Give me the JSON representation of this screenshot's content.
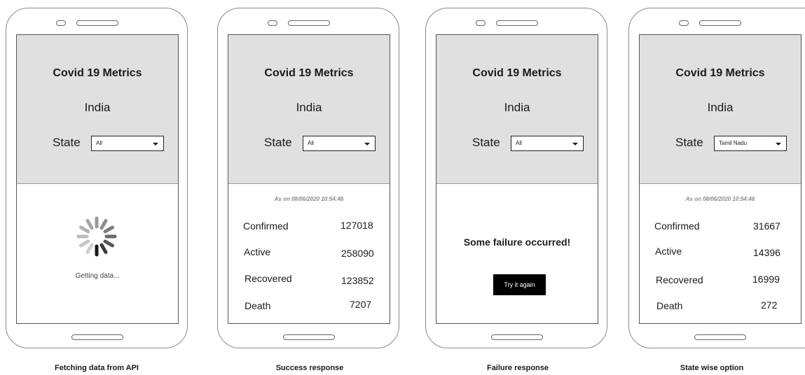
{
  "screens": [
    {
      "caption": "Fetching data from API",
      "title": "Covid 19 Metrics",
      "country": "India",
      "state_label": "State",
      "state_selected": "All",
      "status_text": "Getting data..."
    },
    {
      "caption": "Success response",
      "title": "Covid 19 Metrics",
      "country": "India",
      "state_label": "State",
      "state_selected": "All",
      "as_of": "As on 08/06/2020 10:54:46",
      "metrics": [
        {
          "label": "Confirmed",
          "value": "127018"
        },
        {
          "label": "Active",
          "value": "258090"
        },
        {
          "label": "Recovered",
          "value": "123852"
        },
        {
          "label": "Death",
          "value": "7207"
        }
      ]
    },
    {
      "caption": "Failure response",
      "title": "Covid 19 Metrics",
      "country": "India",
      "state_label": "State",
      "state_selected": "All",
      "failure_message": "Some failure occurred!",
      "retry_label": "Try it again"
    },
    {
      "caption": "State wise option",
      "title": "Covid 19 Metrics",
      "country": "India",
      "state_label": "State",
      "state_selected": "Tamil Nadu",
      "as_of": "As on 08/06/2020 10:54:46",
      "metrics": [
        {
          "label": "Confirmed",
          "value": "31667"
        },
        {
          "label": "Active",
          "value": "14396"
        },
        {
          "label": "Recovered",
          "value": "16999"
        },
        {
          "label": "Death",
          "value": "272"
        }
      ]
    }
  ]
}
